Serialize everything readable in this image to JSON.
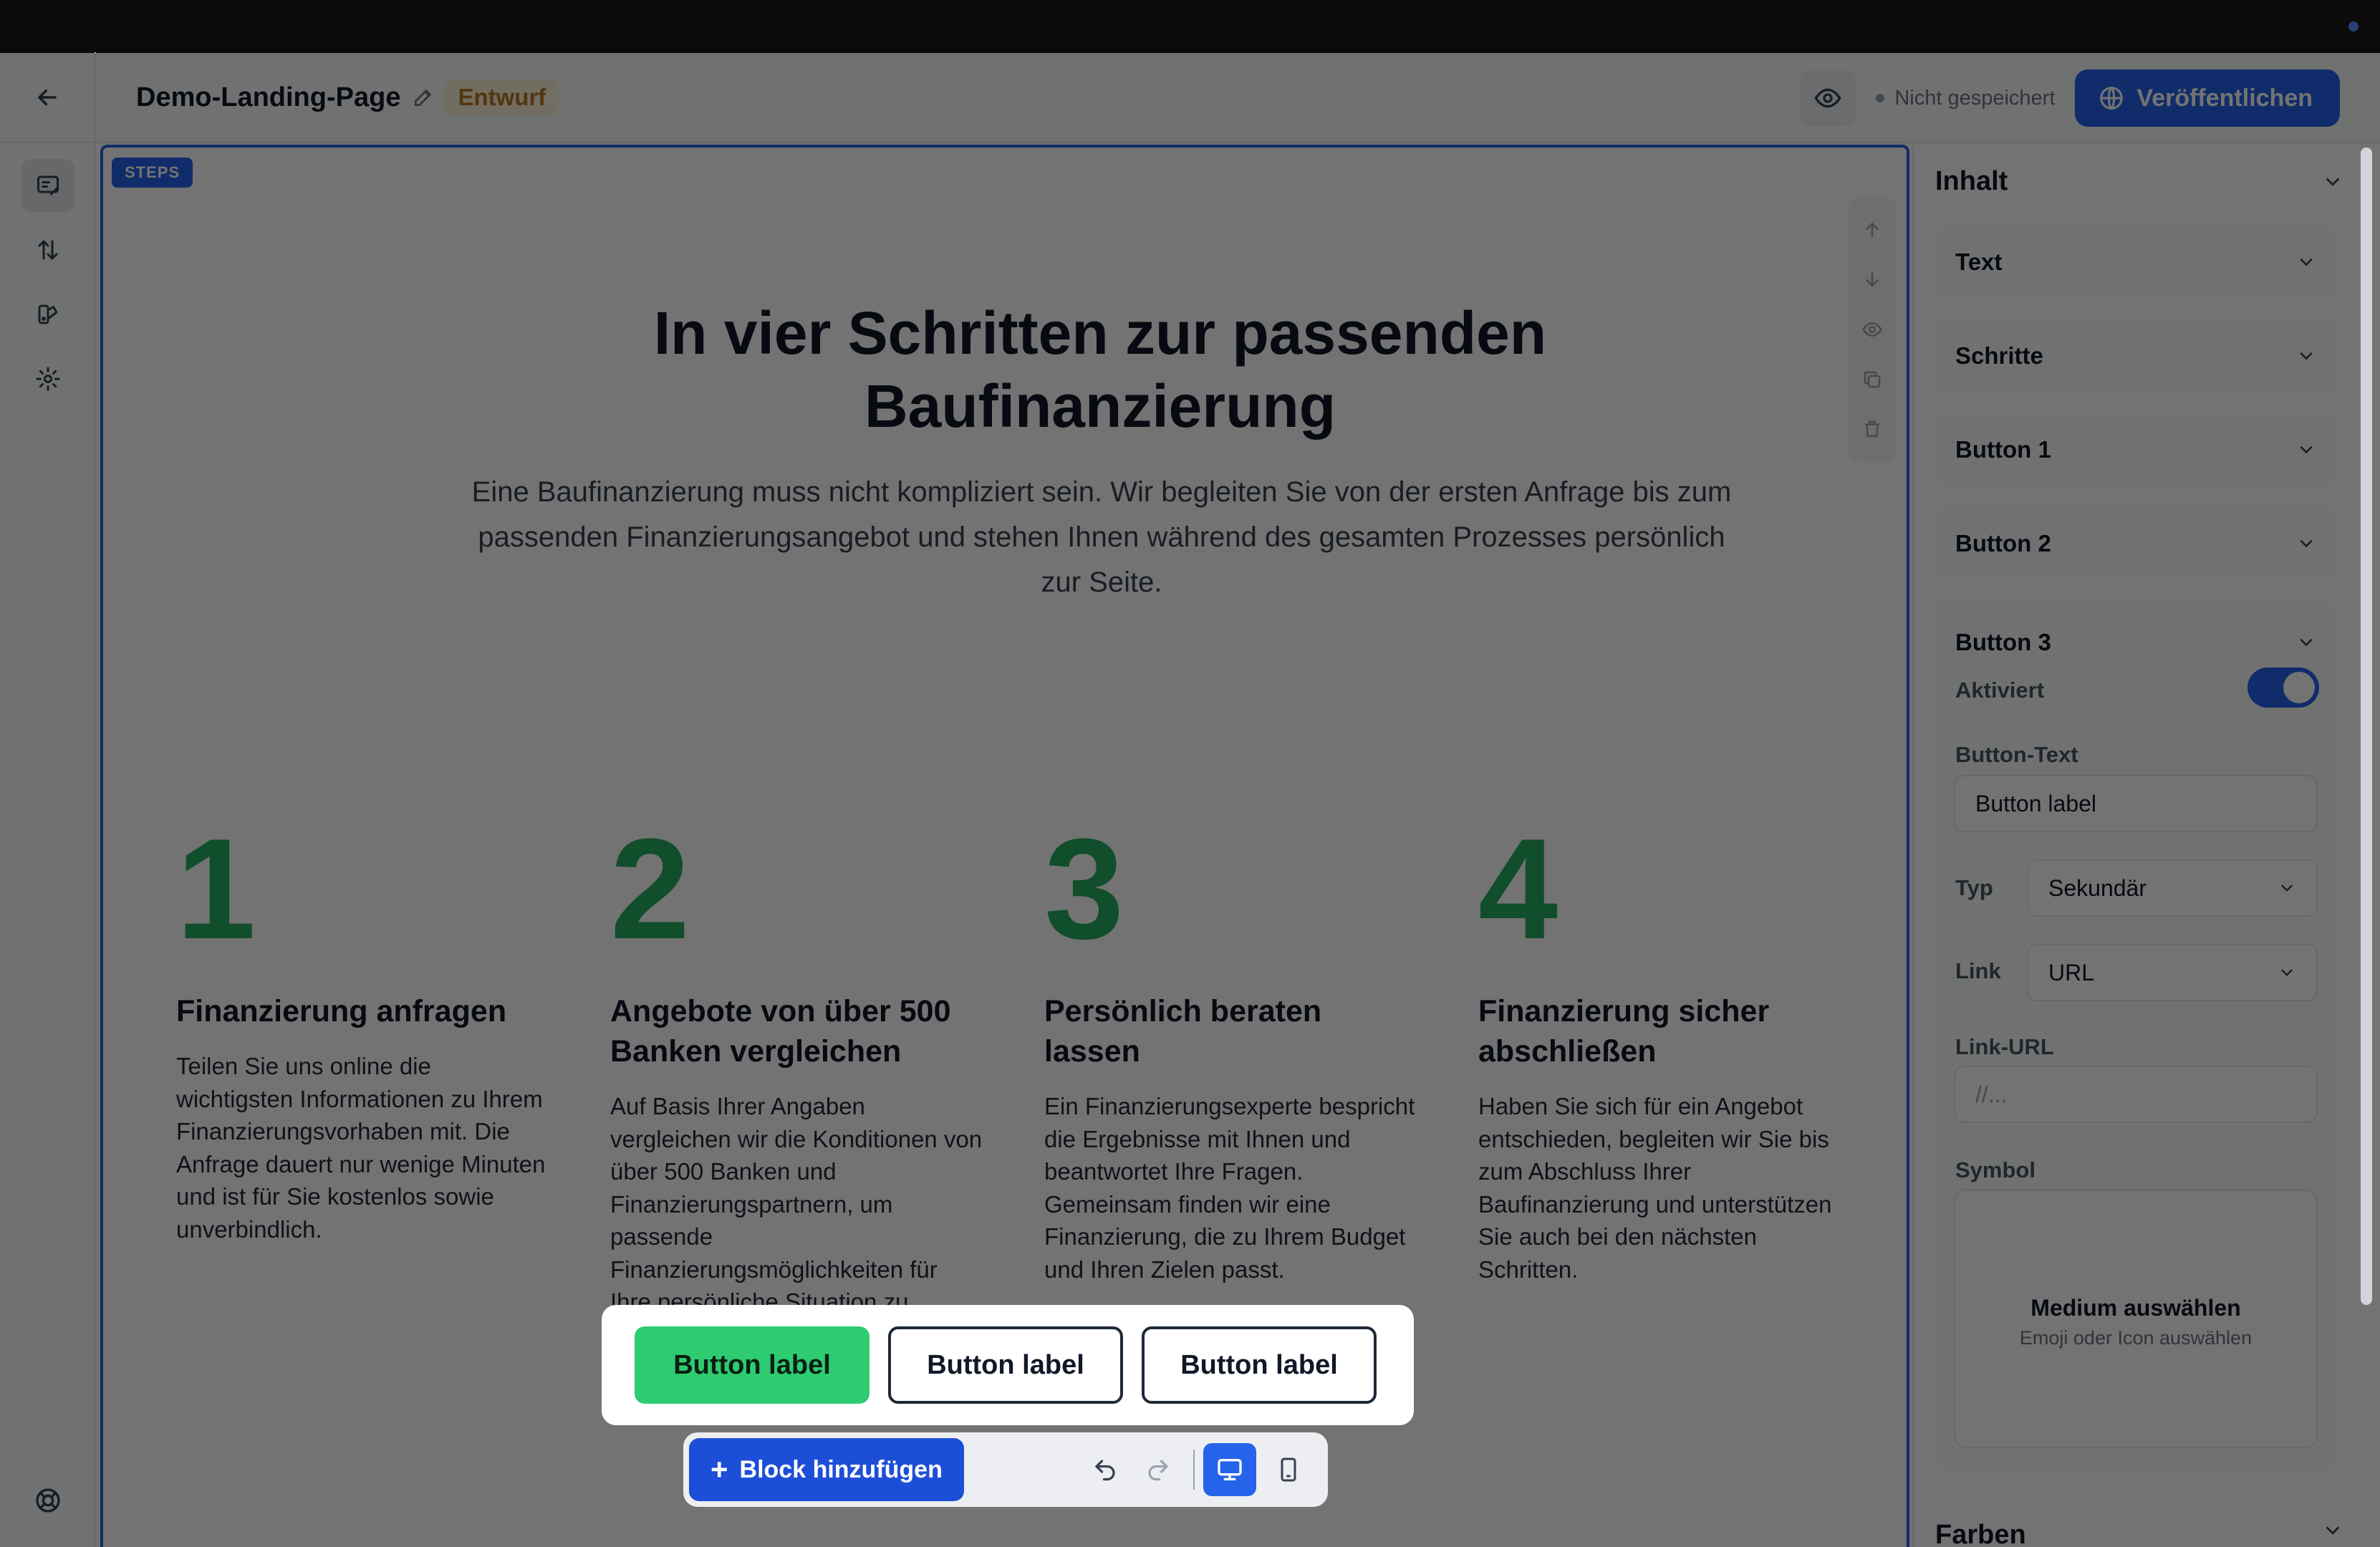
{
  "header": {
    "title": "Demo-Landing-Page",
    "draft_badge": "Entwurf",
    "status": "Nicht gespeichert",
    "publish_label": "Veröffentlichen"
  },
  "canvas": {
    "block_tag": "STEPS",
    "heading": "In vier Schritten zur passenden Baufinanzierung",
    "subtext": "Eine Baufinanzierung muss nicht kompliziert sein. Wir begleiten Sie von der ersten Anfrage bis zum passenden Finanzierungsangebot und stehen Ihnen während des gesamten Prozesses persönlich zur Seite.",
    "steps": [
      {
        "num": "1",
        "title": "Finanzierung anfragen",
        "body": "Teilen Sie uns online die wichtigsten Informationen zu Ihrem Finanzierungsvorhaben mit. Die Anfrage dauert nur wenige Minuten und ist für Sie kostenlos sowie unverbindlich."
      },
      {
        "num": "2",
        "title": "Angebote von über 500 Banken vergleichen",
        "body": "Auf Basis Ihrer Angaben vergleichen wir die Konditionen von über 500 Banken und Finanzierungspartnern, um passende Finanzierungsmöglichkeiten für Ihre persönliche Situation zu finden."
      },
      {
        "num": "3",
        "title": "Persönlich beraten lassen",
        "body": "Ein Finanzierungsexperte bespricht die Ergebnisse mit Ihnen und beantwortet Ihre Fragen. Gemeinsam finden wir eine Finanzierung, die zu Ihrem Budget und Ihren Zielen passt."
      },
      {
        "num": "4",
        "title": "Finanzierung sicher abschließen",
        "body": "Haben Sie sich für ein Angebot entschieden, begleiten wir Sie bis zum Abschluss Ihrer Baufinanzierung und unterstützen Sie auch bei den nächsten Schritten."
      }
    ],
    "buttons": [
      "Button label",
      "Button label",
      "Button label"
    ]
  },
  "toolbar": {
    "add_block_label": "Block hinzufügen"
  },
  "panel": {
    "section_title": "Inhalt",
    "accordions": [
      "Text",
      "Schritte",
      "Button 1",
      "Button 2"
    ],
    "open_accordion": {
      "title": "Button 3",
      "enabled_label": "Aktiviert",
      "enabled": true,
      "text_label": "Button-Text",
      "text_value": "Button label",
      "type_label": "Typ",
      "type_value": "Sekundär",
      "link_label": "Link",
      "link_value": "URL",
      "url_label": "Link-URL",
      "url_placeholder": "//...",
      "symbol_label": "Symbol",
      "media_title": "Medium auswählen",
      "media_sub": "Emoji oder Icon auswählen"
    },
    "next_section": "Farben"
  },
  "colors": {
    "accent": "#2563eb",
    "step_number": "#27ae60",
    "primary_button": "#2ecc71",
    "draft_badge_bg": "#fdf2d8",
    "draft_badge_text": "#b7791f"
  }
}
